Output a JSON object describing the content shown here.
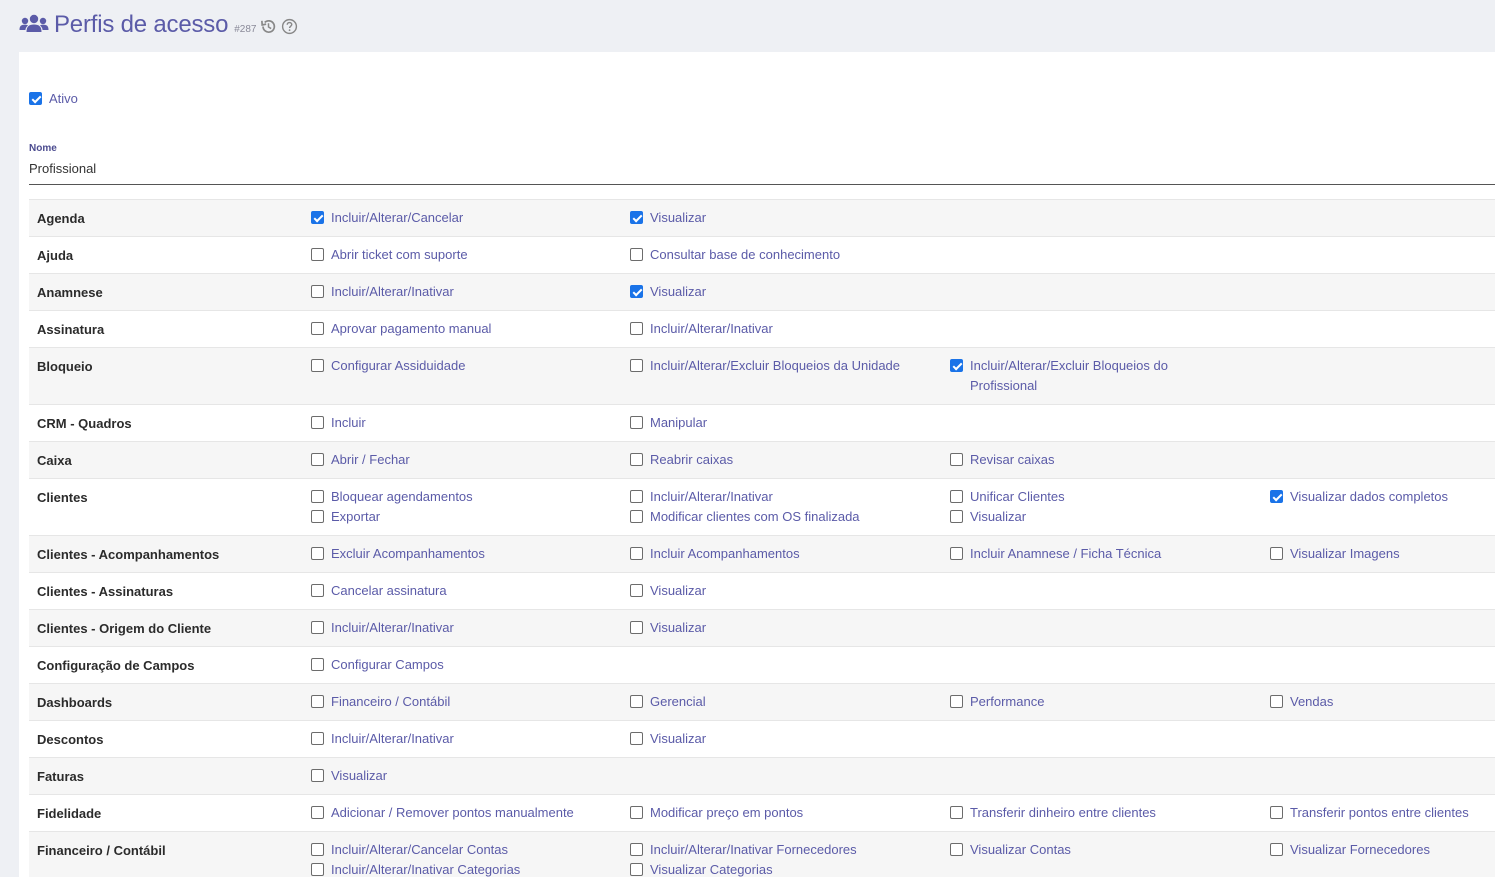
{
  "header": {
    "title": "Perfis de acesso",
    "id": "#287",
    "icons": {
      "users": "users-icon",
      "history": "history-icon",
      "help": "help-icon"
    },
    "accent": "#5b5ba8"
  },
  "form": {
    "ativo": {
      "label": "Ativo",
      "checked": true
    },
    "nome": {
      "label": "Nome",
      "value": "Profissional"
    }
  },
  "modules": [
    {
      "name": "Agenda",
      "perms": [
        [
          {
            "label": "Incluir/Alterar/Cancelar",
            "checked": true
          }
        ],
        [
          {
            "label": "Visualizar",
            "checked": true
          }
        ],
        [],
        []
      ]
    },
    {
      "name": "Ajuda",
      "perms": [
        [
          {
            "label": "Abrir ticket com suporte",
            "checked": false
          }
        ],
        [
          {
            "label": "Consultar base de conhecimento",
            "checked": false
          }
        ],
        [],
        []
      ]
    },
    {
      "name": "Anamnese",
      "perms": [
        [
          {
            "label": "Incluir/Alterar/Inativar",
            "checked": false
          }
        ],
        [
          {
            "label": "Visualizar",
            "checked": true
          }
        ],
        [],
        []
      ]
    },
    {
      "name": "Assinatura",
      "perms": [
        [
          {
            "label": "Aprovar pagamento manual",
            "checked": false
          }
        ],
        [
          {
            "label": "Incluir/Alterar/Inativar",
            "checked": false
          }
        ],
        [],
        []
      ]
    },
    {
      "name": "Bloqueio",
      "perms": [
        [
          {
            "label": "Configurar Assiduidade",
            "checked": false
          }
        ],
        [
          {
            "label": "Incluir/Alterar/Excluir Bloqueios da Unidade",
            "checked": false
          }
        ],
        [
          {
            "label": "Incluir/Alterar/Excluir Bloqueios do Profissional",
            "checked": true
          }
        ],
        []
      ]
    },
    {
      "name": "CRM - Quadros",
      "perms": [
        [
          {
            "label": "Incluir",
            "checked": false
          }
        ],
        [
          {
            "label": "Manipular",
            "checked": false
          }
        ],
        [],
        []
      ]
    },
    {
      "name": "Caixa",
      "perms": [
        [
          {
            "label": "Abrir / Fechar",
            "checked": false
          }
        ],
        [
          {
            "label": "Reabrir caixas",
            "checked": false
          }
        ],
        [
          {
            "label": "Revisar caixas",
            "checked": false
          }
        ],
        []
      ]
    },
    {
      "name": "Clientes",
      "perms": [
        [
          {
            "label": "Bloquear agendamentos",
            "checked": false
          },
          {
            "label": "Exportar",
            "checked": false
          }
        ],
        [
          {
            "label": "Incluir/Alterar/Inativar",
            "checked": false
          },
          {
            "label": "Modificar clientes com OS finalizada",
            "checked": false
          }
        ],
        [
          {
            "label": "Unificar Clientes",
            "checked": false
          },
          {
            "label": "Visualizar",
            "checked": false
          }
        ],
        [
          {
            "label": "Visualizar dados completos",
            "checked": true
          }
        ]
      ]
    },
    {
      "name": "Clientes - Acompanhamentos",
      "perms": [
        [
          {
            "label": "Excluir Acompanhamentos",
            "checked": false
          }
        ],
        [
          {
            "label": "Incluir Acompanhamentos",
            "checked": false
          }
        ],
        [
          {
            "label": "Incluir Anamnese / Ficha Técnica",
            "checked": false
          }
        ],
        [
          {
            "label": "Visualizar Imagens",
            "checked": false
          }
        ]
      ]
    },
    {
      "name": "Clientes - Assinaturas",
      "perms": [
        [
          {
            "label": "Cancelar assinatura",
            "checked": false
          }
        ],
        [
          {
            "label": "Visualizar",
            "checked": false
          }
        ],
        [],
        []
      ]
    },
    {
      "name": "Clientes - Origem do Cliente",
      "perms": [
        [
          {
            "label": "Incluir/Alterar/Inativar",
            "checked": false
          }
        ],
        [
          {
            "label": "Visualizar",
            "checked": false
          }
        ],
        [],
        []
      ]
    },
    {
      "name": "Configuração de Campos",
      "perms": [
        [
          {
            "label": "Configurar Campos",
            "checked": false
          }
        ],
        [],
        [],
        []
      ]
    },
    {
      "name": "Dashboards",
      "perms": [
        [
          {
            "label": "Financeiro / Contábil",
            "checked": false
          }
        ],
        [
          {
            "label": "Gerencial",
            "checked": false
          }
        ],
        [
          {
            "label": "Performance",
            "checked": false
          }
        ],
        [
          {
            "label": "Vendas",
            "checked": false
          }
        ]
      ]
    },
    {
      "name": "Descontos",
      "perms": [
        [
          {
            "label": "Incluir/Alterar/Inativar",
            "checked": false
          }
        ],
        [
          {
            "label": "Visualizar",
            "checked": false
          }
        ],
        [],
        []
      ]
    },
    {
      "name": "Faturas",
      "perms": [
        [
          {
            "label": "Visualizar",
            "checked": false
          }
        ],
        [],
        [],
        []
      ]
    },
    {
      "name": "Fidelidade",
      "perms": [
        [
          {
            "label": "Adicionar / Remover pontos manualmente",
            "checked": false
          }
        ],
        [
          {
            "label": "Modificar preço em pontos",
            "checked": false
          }
        ],
        [
          {
            "label": "Transferir dinheiro entre clientes",
            "checked": false
          }
        ],
        [
          {
            "label": "Transferir pontos entre clientes",
            "checked": false
          }
        ]
      ]
    },
    {
      "name": "Financeiro / Contábil",
      "perms": [
        [
          {
            "label": "Incluir/Alterar/Cancelar Contas",
            "checked": false
          },
          {
            "label": "Incluir/Alterar/Inativar Categorias",
            "checked": false
          }
        ],
        [
          {
            "label": "Incluir/Alterar/Inativar Fornecedores",
            "checked": false
          },
          {
            "label": "Visualizar Categorias",
            "checked": false
          }
        ],
        [
          {
            "label": "Visualizar Contas",
            "checked": false
          }
        ],
        [
          {
            "label": "Visualizar Fornecedores",
            "checked": false
          }
        ]
      ]
    }
  ]
}
